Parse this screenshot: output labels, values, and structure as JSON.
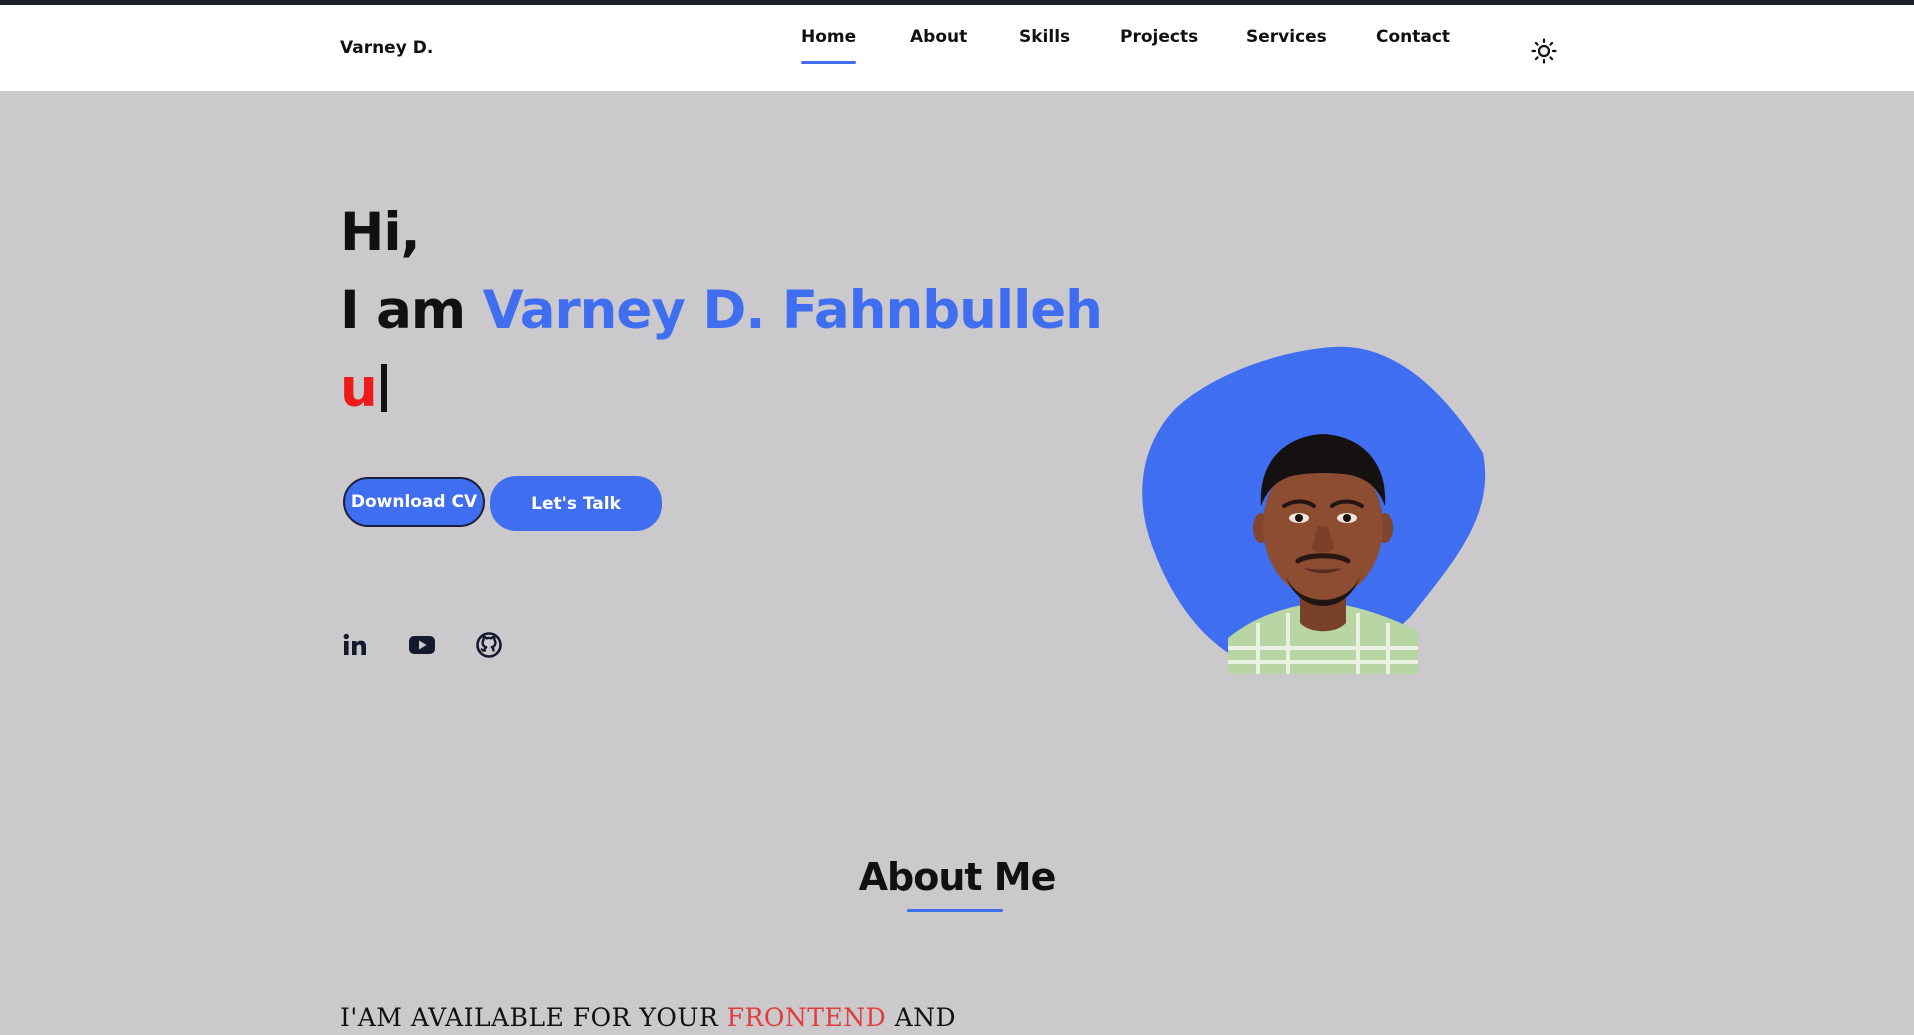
{
  "header": {
    "logo": "Varney D.",
    "nav": [
      {
        "label": "Home",
        "active": true
      },
      {
        "label": "About"
      },
      {
        "label": "Skills"
      },
      {
        "label": "Projects"
      },
      {
        "label": "Services"
      },
      {
        "label": "Contact"
      }
    ],
    "theme_icon": "sun-icon"
  },
  "hero": {
    "greeting": "Hi,",
    "intro_prefix": "I am",
    "name": "Varney D. Fahnbulleh",
    "typed_text": "u",
    "buttons": {
      "download_cv": "Download CV",
      "lets_talk": "Let's Talk"
    },
    "socials": [
      "linkedin-icon",
      "youtube-icon",
      "github-icon"
    ],
    "colors": {
      "accent": "#3f6ef1",
      "typed": "#ee1b1b",
      "background": "#cbc9cb"
    }
  },
  "about": {
    "title": "About Me",
    "availability": {
      "prefix": "I'AM AVAILABLE FOR YOUR",
      "highlight": "FRONTEND",
      "suffix": "AND"
    }
  }
}
